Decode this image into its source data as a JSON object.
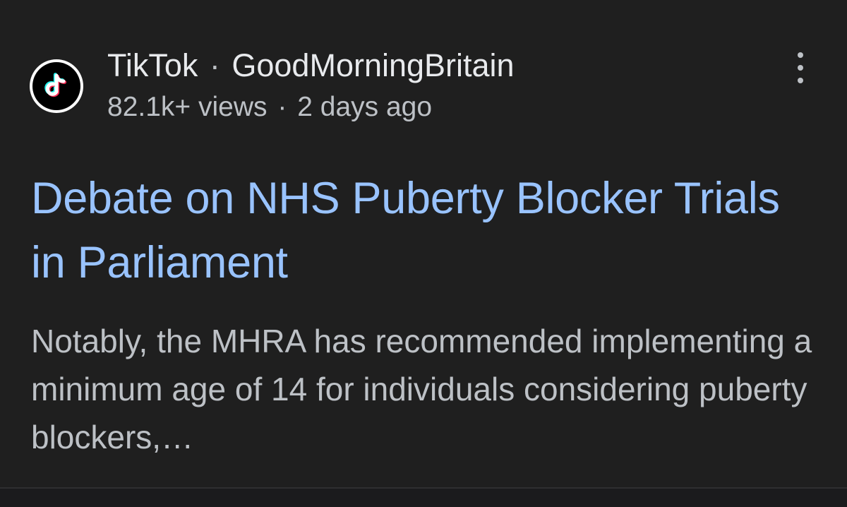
{
  "result": {
    "source": {
      "name": "TikTok",
      "separator": "·",
      "channel": "GoodMorningBritain",
      "favicon": "tiktok-logo-icon",
      "views": "82.1k+ views",
      "meta_separator": "·",
      "age": "2 days ago"
    },
    "more_button_icon": "more-vertical-icon",
    "title": "Debate on NHS Puberty Blocker Trials in Parliament",
    "snippet": "Notably, the MHRA has recommended implementing a minimum age of 14 for individuals considering puberty blockers,…"
  },
  "colors": {
    "background": "#1f1f1f",
    "title_link": "#99c3ff",
    "primary_text": "#e8eaed",
    "secondary_text": "#bdc1c6",
    "tiktok_cyan": "#25f4ee",
    "tiktok_red": "#fe2c55"
  }
}
